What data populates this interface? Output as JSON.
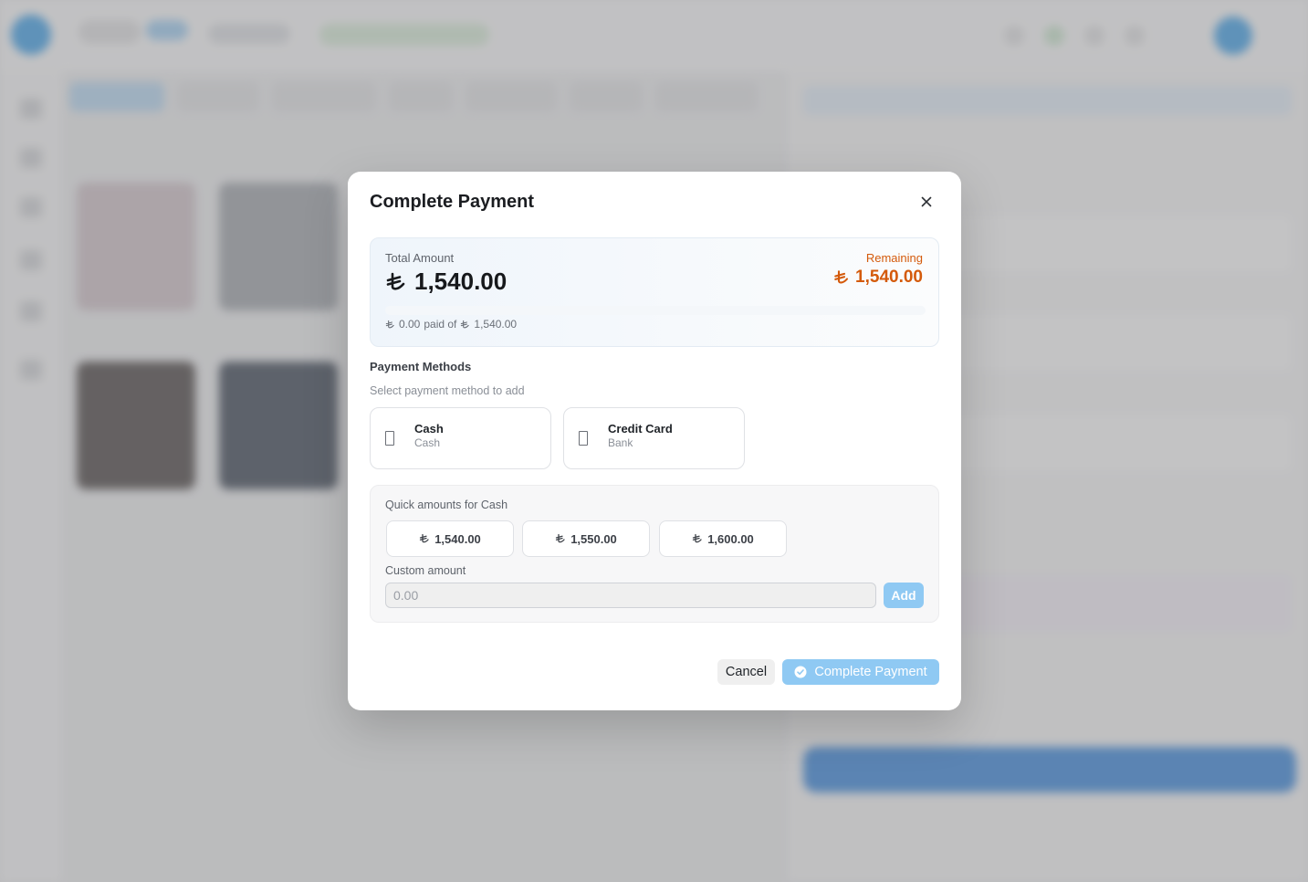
{
  "modal": {
    "title": "Complete Payment",
    "close_icon": "close-icon"
  },
  "summary": {
    "total_label": "Total Amount",
    "total_value": "1,540.00",
    "remaining_label": "Remaining",
    "remaining_value": "1,540.00",
    "progress_fraction": 0,
    "paid_amount": "0.00",
    "paid_of_text": "paid of",
    "paid_total": "1,540.00",
    "currency_icon": "turkish-lira-icon"
  },
  "payment_methods": {
    "title": "Payment Methods",
    "subtitle": "Select payment method to add",
    "items": [
      {
        "name": "Cash",
        "type": "Cash",
        "icon": "cash-icon"
      },
      {
        "name": "Credit Card",
        "type": "Bank",
        "icon": "credit-card-icon"
      }
    ]
  },
  "quick_amounts": {
    "title": "Quick amounts for Cash",
    "amounts": [
      "1,540.00",
      "1,550.00",
      "1,600.00"
    ],
    "custom_label": "Custom amount",
    "custom_placeholder": "0.00",
    "add_label": "Add"
  },
  "footer": {
    "cancel_label": "Cancel",
    "complete_label": "Complete Payment",
    "complete_icon": "check-circle-icon"
  },
  "colors": {
    "accent": "#1d8fe3",
    "accent_disabled": "#8fc9f3",
    "remaining": "#d45a0b"
  }
}
